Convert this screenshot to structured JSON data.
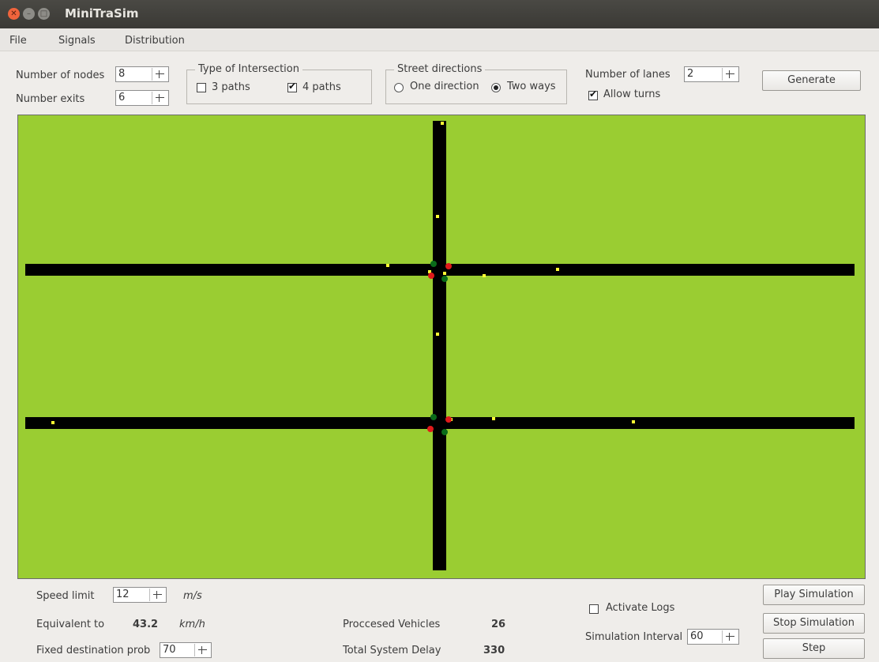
{
  "window": {
    "title": "MiniTraSim"
  },
  "menu": [
    "File",
    "Signals",
    "Distribution"
  ],
  "controls": {
    "nodes_label": "Number of nodes",
    "nodes_value": "8",
    "exits_label": "Number exits",
    "exits_value": "6",
    "intersection_title": "Type of Intersection",
    "three_paths_label": "3 paths",
    "three_paths_checked": false,
    "four_paths_label": "4 paths",
    "four_paths_checked": true,
    "directions_title": "Street directions",
    "one_direction_label": "One direction",
    "two_ways_label": "Two ways",
    "direction_selected": "Two ways",
    "lanes_label": "Number of lanes",
    "lanes_value": "2",
    "allow_turns_label": "Allow turns",
    "allow_turns_checked": true,
    "generate_label": "Generate"
  },
  "footer": {
    "speed_label": "Speed limit",
    "speed_value": "12",
    "speed_unit": "m/s",
    "equiv_label": "Equivalent to",
    "equiv_value": "43.2",
    "equiv_unit": "km/h",
    "fixed_prob_label": "Fixed destination prob",
    "fixed_prob_value": "70",
    "processed_label": "Proccesed Vehicles",
    "processed_value": "26",
    "delay_label": "Total System Delay",
    "delay_value": "330",
    "logs_label": "Activate Logs",
    "logs_checked": false,
    "interval_label": "Simulation Interval",
    "interval_value": "60",
    "play_label": "Play Simulation",
    "stop_label": "Stop Simulation",
    "step_label": "Step"
  },
  "colors": {
    "grass": "#9acd32",
    "road": "#000000",
    "vehicle": "#ffff33",
    "signal_red": "#e01a1a",
    "signal_green": "#0a6b1a"
  }
}
